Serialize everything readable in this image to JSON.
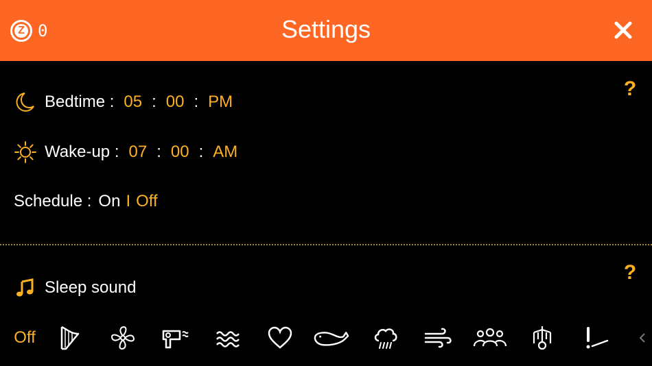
{
  "header": {
    "title": "Settings",
    "coins": "0",
    "coin_icon_letter": "Z",
    "background": "#fd6623"
  },
  "schedule": {
    "bedtime_label": "Bedtime :",
    "bedtime_hour": "05",
    "bedtime_minute": "00",
    "bedtime_ampm": "PM",
    "wake_label": "Wake-up :",
    "wake_hour": "07",
    "wake_minute": "00",
    "wake_ampm": "AM",
    "colon": ":",
    "schedule_label": "Schedule :",
    "on_label": "On",
    "divider_char": "I",
    "off_label": "Off",
    "help": "?"
  },
  "sleep_sound": {
    "label": "Sleep sound",
    "help": "?",
    "off_label": "Off",
    "items": [
      "harp-icon",
      "fan-icon",
      "hair-dryer-icon",
      "waves-icon",
      "heart-icon",
      "whale-icon",
      "rain-icon",
      "wind-icon",
      "crowd-icon",
      "mobile-icon",
      "metronome-icon",
      "speaker-icon"
    ]
  },
  "colors": {
    "accent": "#fdb022",
    "header": "#fd6623"
  }
}
